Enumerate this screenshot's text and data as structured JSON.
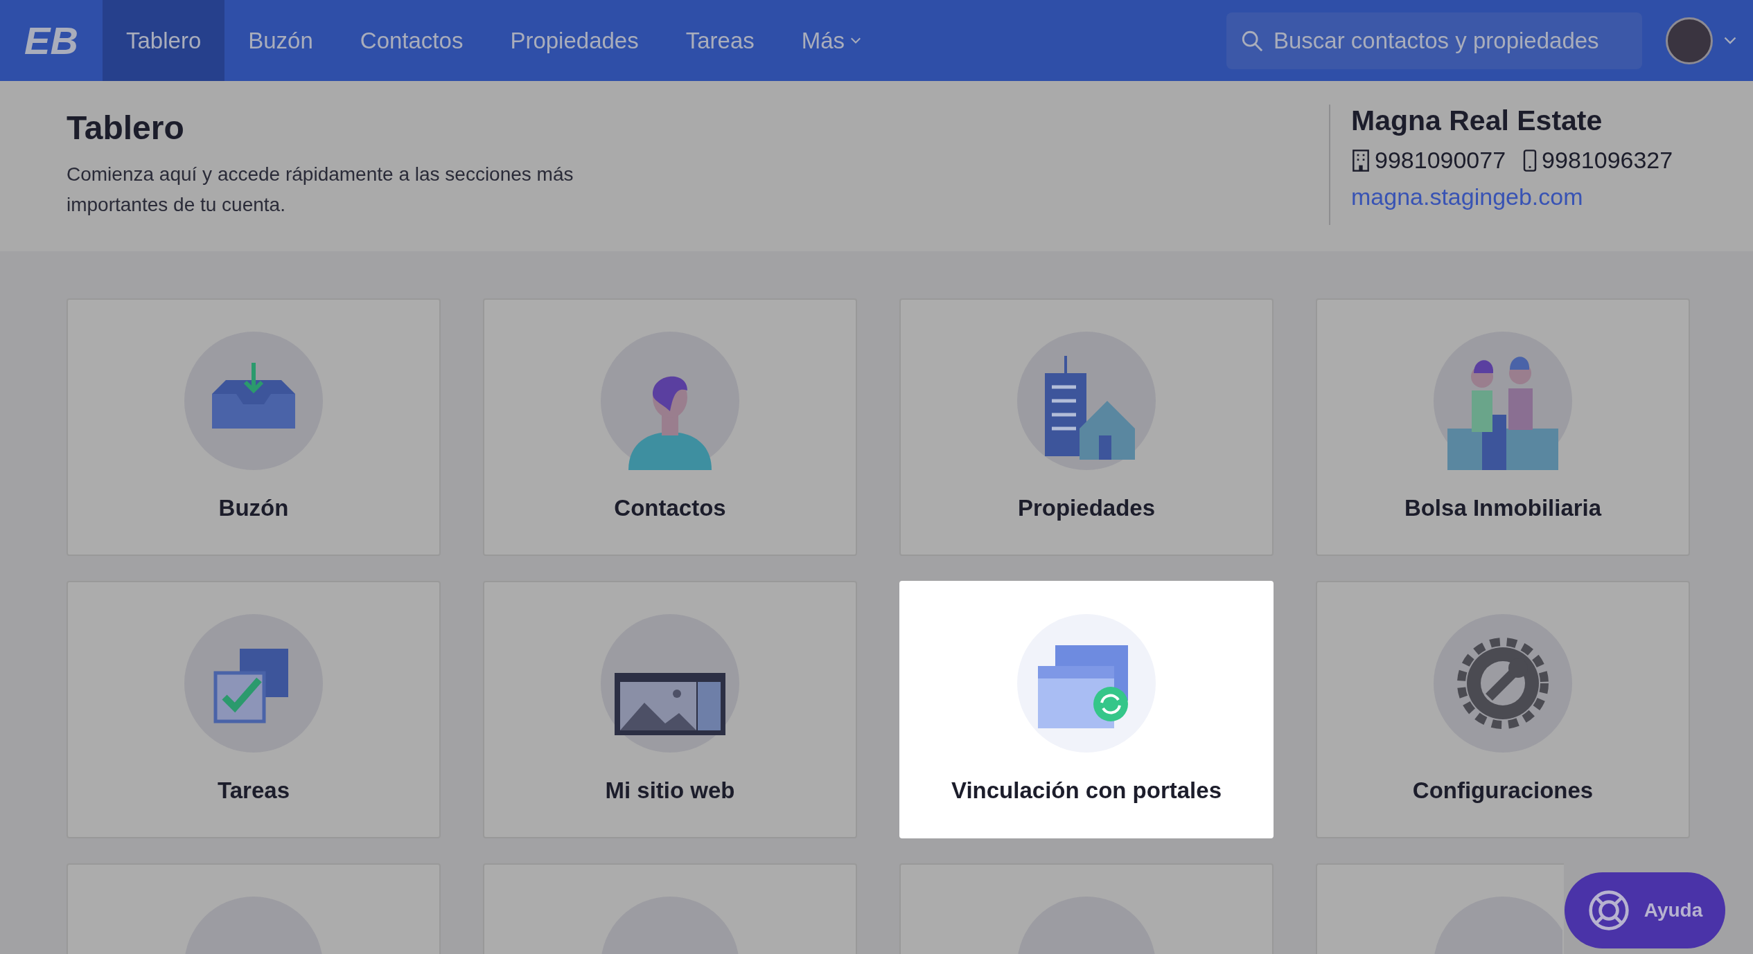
{
  "nav": {
    "logo": "EB",
    "items": [
      {
        "label": "Tablero",
        "selected": true
      },
      {
        "label": "Buzón",
        "selected": false
      },
      {
        "label": "Contactos",
        "selected": false
      },
      {
        "label": "Propiedades",
        "selected": false
      },
      {
        "label": "Tareas",
        "selected": false
      },
      {
        "label": "Más",
        "selected": false,
        "kind": "menu"
      }
    ],
    "search": {
      "placeholder": "Buscar contactos y propiedades"
    }
  },
  "header": {
    "title": "Tablero",
    "description": "Comienza aquí y accede rápidamente a las secciones más importantes de tu cuenta."
  },
  "account": {
    "name": "Magna Real Estate",
    "office_phone": "9981090077",
    "mobile_phone": "9981096327",
    "website": "magna.stagingeb.com"
  },
  "cards": [
    {
      "label": "Buzón",
      "highlighted": false
    },
    {
      "label": "Contactos",
      "highlighted": false
    },
    {
      "label": "Propiedades",
      "highlighted": false
    },
    {
      "label": "Bolsa Inmobiliaria",
      "highlighted": false
    },
    {
      "label": "Tareas",
      "highlighted": false
    },
    {
      "label": "Mi sitio web",
      "highlighted": false
    },
    {
      "label": "Vinculación con portales",
      "highlighted": true
    },
    {
      "label": "Configuraciones",
      "highlighted": false
    }
  ],
  "help_button": {
    "label": "Ayuda"
  }
}
